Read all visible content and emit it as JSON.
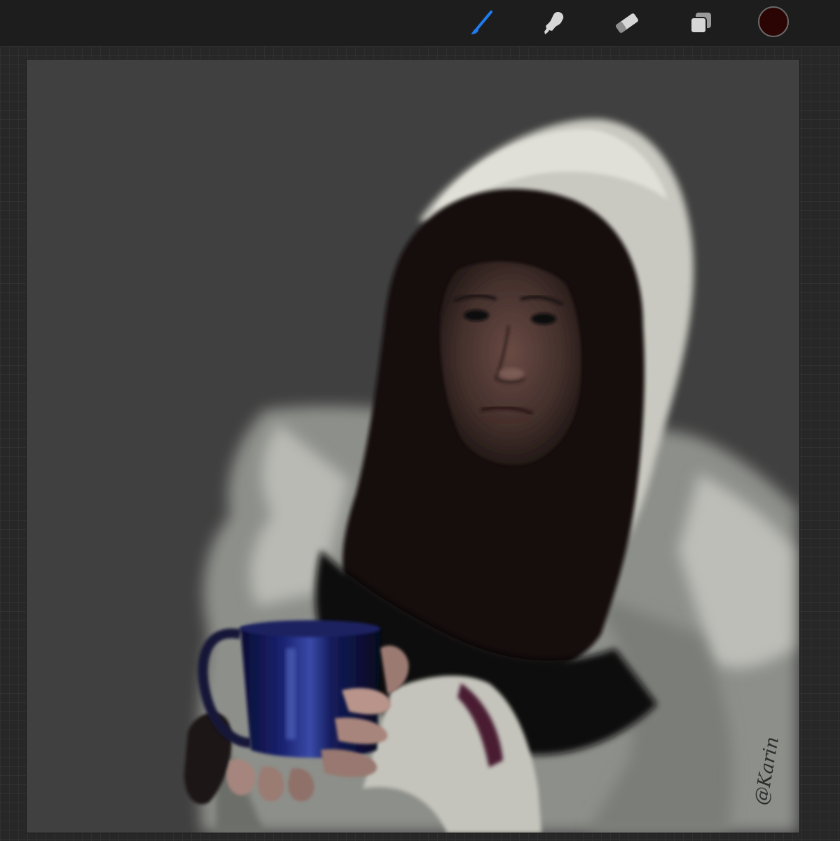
{
  "app": {
    "toolbar": {
      "tools": [
        {
          "name": "brush",
          "icon": "brush-icon",
          "active": true
        },
        {
          "name": "smudge",
          "icon": "smudge-icon",
          "active": false
        },
        {
          "name": "eraser",
          "icon": "eraser-icon",
          "active": false
        },
        {
          "name": "layers",
          "icon": "layers-icon",
          "active": false
        }
      ],
      "current_color": "#2b0503"
    },
    "colors": {
      "active_tool": "#1f7cf0",
      "inactive_tool": "#d6d6d6",
      "toolbar_bg": "#1d1d1d",
      "canvas_bg": "#404040"
    }
  },
  "artwork": {
    "signature": "@Karin"
  }
}
